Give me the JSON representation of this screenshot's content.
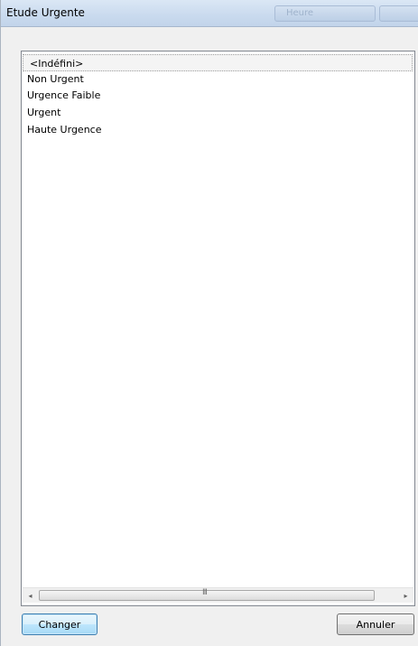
{
  "window": {
    "title": "Etude Urgente",
    "title_ghost_1": "Heure",
    "title_ghost_2": ""
  },
  "list": {
    "items": [
      "<Indéfini>",
      "Non Urgent",
      "Urgence Faible",
      "Urgent",
      "Haute Urgence"
    ],
    "selected_index": 0
  },
  "scrollbar": {
    "left_arrow": "◂",
    "right_arrow": "▸",
    "grip": "III"
  },
  "buttons": {
    "change_label": "Changer",
    "cancel_label": "Annuler"
  }
}
